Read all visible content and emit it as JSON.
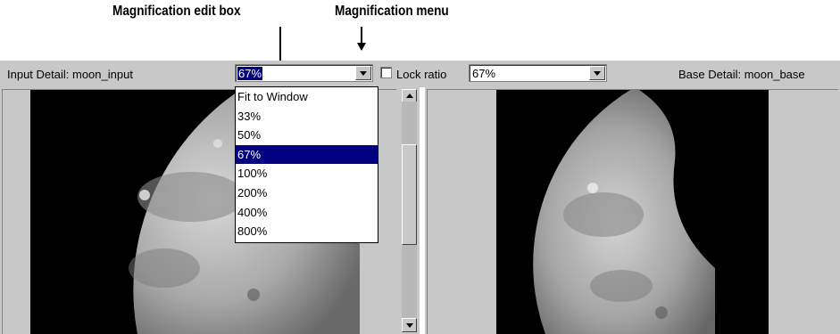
{
  "annotations": {
    "edit_box": "Magnification edit box",
    "menu": "Magnification menu"
  },
  "toolbar": {
    "input_label": "Input Detail: moon_input",
    "left_combo_value": "67%",
    "lock_ratio_label": "Lock ratio",
    "right_combo_value": "67%",
    "base_label": "Base Detail: moon_base"
  },
  "dropdown": {
    "options": [
      "Fit to Window",
      "33%",
      "50%",
      "67%",
      "100%",
      "200%",
      "400%",
      "800%"
    ],
    "selected": "67%"
  },
  "colors": {
    "panel": "#c8c8c8",
    "selection": "#000080"
  }
}
